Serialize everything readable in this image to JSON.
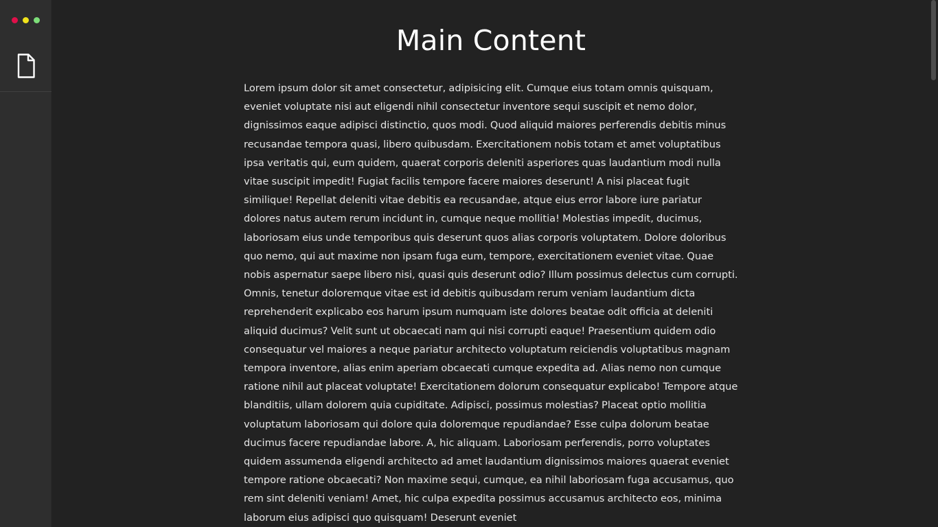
{
  "window": {
    "controls": [
      {
        "name": "close",
        "color": "#e0104a"
      },
      {
        "name": "minimize",
        "color": "#f1e31b"
      },
      {
        "name": "maximize",
        "color": "#7dde79"
      }
    ]
  },
  "sidebar": {
    "items": [
      {
        "icon": "document-icon"
      }
    ]
  },
  "main": {
    "title": "Main Content",
    "body": "Lorem ipsum dolor sit amet consectetur, adipisicing elit. Cumque eius totam omnis quisquam, eveniet voluptate nisi aut eligendi nihil consectetur inventore sequi suscipit et nemo dolor, dignissimos eaque adipisci distinctio, quos modi. Quod aliquid maiores perferendis debitis minus recusandae tempora quasi, libero quibusdam. Exercitationem nobis totam et amet voluptatibus ipsa veritatis qui, eum quidem, quaerat corporis deleniti asperiores quas laudantium modi nulla vitae suscipit impedit! Fugiat facilis tempore facere maiores deserunt! A nisi placeat fugit similique! Repellat deleniti vitae debitis ea recusandae, atque eius error labore iure pariatur dolores natus autem rerum incidunt in, cumque neque mollitia! Molestias impedit, ducimus, laboriosam eius unde temporibus quis deserunt quos alias corporis voluptatem. Dolore doloribus quo nemo, qui aut maxime non ipsam fuga eum, tempore, exercitationem eveniet vitae. Quae nobis aspernatur saepe libero nisi, quasi quis deserunt odio? Illum possimus delectus cum corrupti. Omnis, tenetur doloremque vitae est id debitis quibusdam rerum veniam laudantium dicta reprehenderit explicabo eos harum ipsum numquam iste dolores beatae odit officia at deleniti aliquid ducimus? Velit sunt ut obcaecati nam qui nisi corrupti eaque! Praesentium quidem odio consequatur vel maiores a neque pariatur architecto voluptatum reiciendis voluptatibus magnam tempora inventore, alias enim aperiam obcaecati cumque expedita ad. Alias nemo non cumque ratione nihil aut placeat voluptate! Exercitationem dolorum consequatur explicabo! Tempore atque blanditiis, ullam dolorem quia cupiditate. Adipisci, possimus molestias? Placeat optio mollitia voluptatum laboriosam qui dolore quia doloremque repudiandae? Esse culpa dolorum beatae ducimus facere repudiandae labore. A, hic aliquam. Laboriosam perferendis, porro voluptates quidem assumenda eligendi architecto ad amet laudantium dignissimos maiores quaerat eveniet tempore ratione obcaecati? Non maxime sequi, cumque, ea nihil laboriosam fuga accusamus, quo rem sint deleniti veniam! Amet, hic culpa expedita possimus accusamus architecto eos, minima laborum eius adipisci quo quisquam! Deserunt eveniet"
  }
}
